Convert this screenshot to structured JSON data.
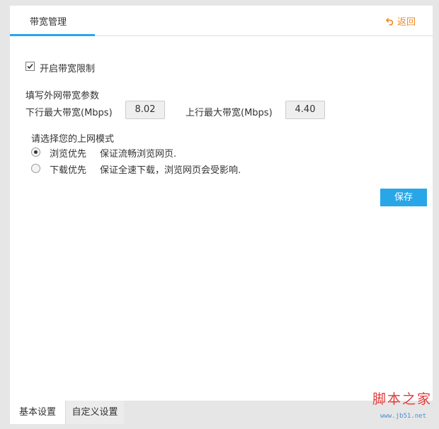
{
  "header": {
    "tab_label": "带宽管理",
    "back_label": "返回"
  },
  "settings": {
    "enable_limit_label": "开启带宽限制",
    "enable_limit_checked": true,
    "params_title": "填写外网带宽参数",
    "download_label": "下行最大带宽(Mbps)",
    "download_value": "8.02",
    "upload_label": "上行最大带宽(Mbps)",
    "upload_value": "4.40",
    "mode_title": "请选择您的上网模式",
    "modes": [
      {
        "label": "浏览优先",
        "desc": "保证流畅浏览网页.",
        "selected": true
      },
      {
        "label": "下载优先",
        "desc": "保证全速下载，浏览网页会受影响.",
        "selected": false
      }
    ],
    "save_label": "保存"
  },
  "bottom_tabs": {
    "basic": "基本设置",
    "custom": "自定义设置"
  },
  "watermark": {
    "text": "脚本之家",
    "url": "www.jb51.net"
  },
  "colors": {
    "accent": "#29a6e8",
    "back": "#f08a28"
  }
}
